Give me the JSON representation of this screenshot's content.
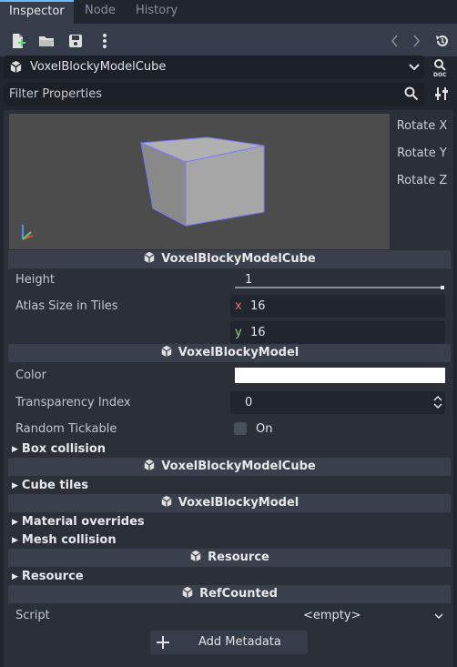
{
  "tabs": [
    "Inspector",
    "Node",
    "History"
  ],
  "object": {
    "name": "VoxelBlockyModelCube"
  },
  "filter": {
    "placeholder": "Filter Properties"
  },
  "preview": {
    "rotate_x": "Rotate X",
    "rotate_y": "Rotate Y",
    "rotate_z": "Rotate Z"
  },
  "sections": {
    "s1": "VoxelBlockyModelCube",
    "s2": "VoxelBlockyModel",
    "s3": "VoxelBlockyModelCube",
    "s4": "VoxelBlockyModel",
    "s5": "Resource",
    "s6": "RefCounted"
  },
  "props": {
    "height_label": "Height",
    "height_value": "1",
    "height_fraction": 1.0,
    "atlas_label": "Atlas Size in Tiles",
    "atlas_x_axis": "x",
    "atlas_x": "16",
    "atlas_y_axis": "y",
    "atlas_y": "16",
    "color_label": "Color",
    "color_value": "#ffffff",
    "transparency_label": "Transparency Index",
    "transparency_value": "0",
    "random_tickable_label": "Random Tickable",
    "random_tickable_value": "On",
    "script_label": "Script",
    "script_value": "<empty>"
  },
  "groups": {
    "box_collision": "Box collision",
    "cube_tiles": "Cube tiles",
    "material_overrides": "Material overrides",
    "mesh_collision": "Mesh collision",
    "resource": "Resource"
  },
  "add_metadata": "Add Metadata",
  "icons": {
    "new": "new-resource-icon",
    "open": "folder-open-icon",
    "save": "save-icon",
    "more": "more-vertical-icon",
    "back": "chevron-left-icon",
    "forward": "chevron-right-icon",
    "history": "history-icon",
    "doc": "doc-icon",
    "search": "search-icon",
    "tools": "tools-icon"
  },
  "colors": {
    "accent": "#70bafa",
    "panel": "#2a2f38",
    "section": "#3a404b"
  }
}
